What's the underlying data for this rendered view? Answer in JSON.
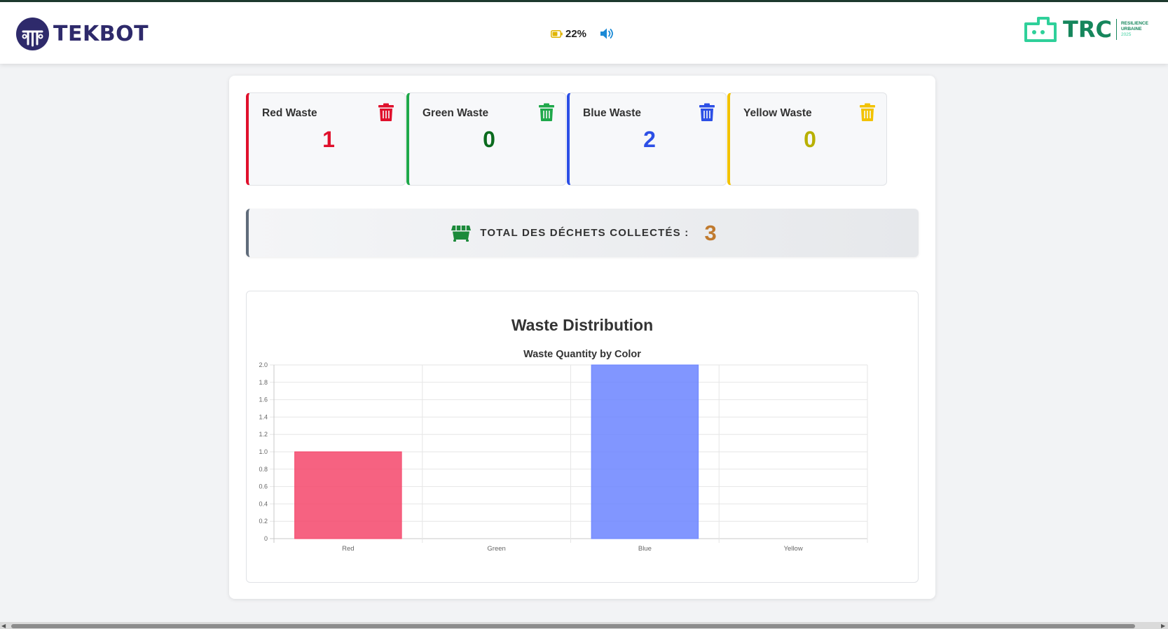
{
  "header": {
    "brand_left": "TEKBOT",
    "battery_percent": "22%",
    "brand_right": "TRC",
    "brand_right_tagline": [
      "RESILIENCE",
      "URBAINE",
      "2025"
    ],
    "icons": [
      "battery-icon",
      "volume-icon"
    ]
  },
  "cards": [
    {
      "title": "Red Waste",
      "count": "1",
      "color": "#e0102c"
    },
    {
      "title": "Green Waste",
      "count": "0",
      "color": "#0b6b1e"
    },
    {
      "title": "Blue Waste",
      "count": "2",
      "color": "#2c4fe6"
    },
    {
      "title": "Yellow Waste",
      "count": "0",
      "color": "#b8b000"
    }
  ],
  "card_accents": [
    "#e0102c",
    "#1ea84a",
    "#2c4fe6",
    "#f2c200"
  ],
  "total": {
    "label": "TOTAL DES DÉCHETS COLLECTÉS :",
    "value": "3",
    "icon": "dumpster-icon",
    "icon_color": "#1c8a3a"
  },
  "chart_section_title": "Waste Distribution",
  "chart_data": {
    "type": "bar",
    "title": "Waste Quantity by Color",
    "categories": [
      "Red",
      "Green",
      "Blue",
      "Yellow"
    ],
    "values": [
      1,
      0,
      2,
      0
    ],
    "bar_colors": [
      "#f4476b",
      "#2fb34a",
      "#6b84ff",
      "#f2c200"
    ],
    "ylim": [
      0,
      2
    ],
    "yticks": [
      "0",
      "0.2",
      "0.4",
      "0.6",
      "0.8",
      "1.0",
      "1.2",
      "1.4",
      "1.6",
      "1.8",
      "2.0"
    ],
    "grid": true,
    "legend": "none"
  }
}
